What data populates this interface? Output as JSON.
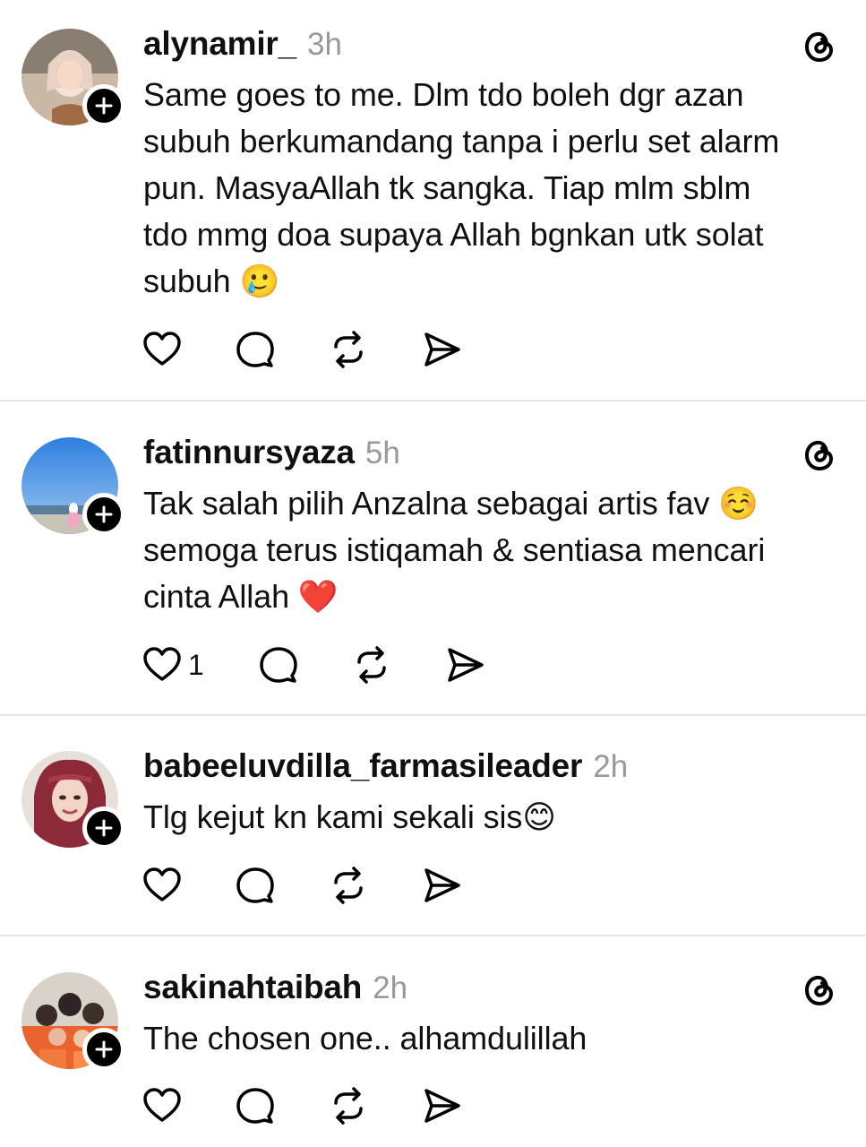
{
  "posts": [
    {
      "username": "alynamir_",
      "time": "3h",
      "text": "Same goes to me. Dlm tdo boleh dgr azan\nsubuh berkumandang tanpa i perlu set alarm\npun. MasyaAllah tk sangka. Tiap mlm sblm\ntdo mmg doa supaya Allah bgnkan utk solat\nsubuh 🥲",
      "like_count": "",
      "show_threads_icon": true
    },
    {
      "username": "fatinnursyaza",
      "time": "5h",
      "text": "Tak salah pilih Anzalna sebagai artis fav ☺️\nsemoga terus istiqamah & sentiasa mencari\ncinta Allah ❤️",
      "like_count": "1",
      "show_threads_icon": true
    },
    {
      "username": "babeeluvdilla_farmasileader",
      "time": "2h",
      "text": "Tlg kejut kn kami sekali sis😊",
      "like_count": "",
      "show_threads_icon": false
    },
    {
      "username": "sakinahtaibah",
      "time": "2h",
      "text": "The chosen one.. alhamdulillah",
      "like_count": "",
      "show_threads_icon": true
    }
  ],
  "icons": {
    "like": "heart-icon",
    "reply": "comment-bubble-icon",
    "repost": "repost-icon",
    "share": "send-icon",
    "threads": "threads-logo-icon",
    "follow": "plus-icon"
  },
  "colors": {
    "text": "#101010",
    "muted": "#999999",
    "divider": "#e6e6e6",
    "badge": "#000000"
  }
}
